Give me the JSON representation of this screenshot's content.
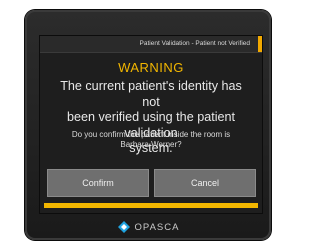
{
  "header": {
    "title": "Patient Validation - Patient not Verified",
    "accent_color": "#f2a900"
  },
  "dialog": {
    "heading": "WARNING",
    "message_lines": [
      "The current patient's identity has not",
      "been verified using the patient validation",
      "system."
    ],
    "question_lines": [
      "Do you confirm the patient inside the room is",
      "Barbara Werner?"
    ],
    "heading_color": "#f2b600"
  },
  "buttons": {
    "confirm_label": "Confirm",
    "cancel_label": "Cancel"
  },
  "progress": {
    "fraction": 1.0,
    "color": "#f2b600"
  },
  "brand": {
    "name": "OPASCA",
    "icon": "opasca-logo-icon",
    "icon_color": "#1fa3e0"
  }
}
